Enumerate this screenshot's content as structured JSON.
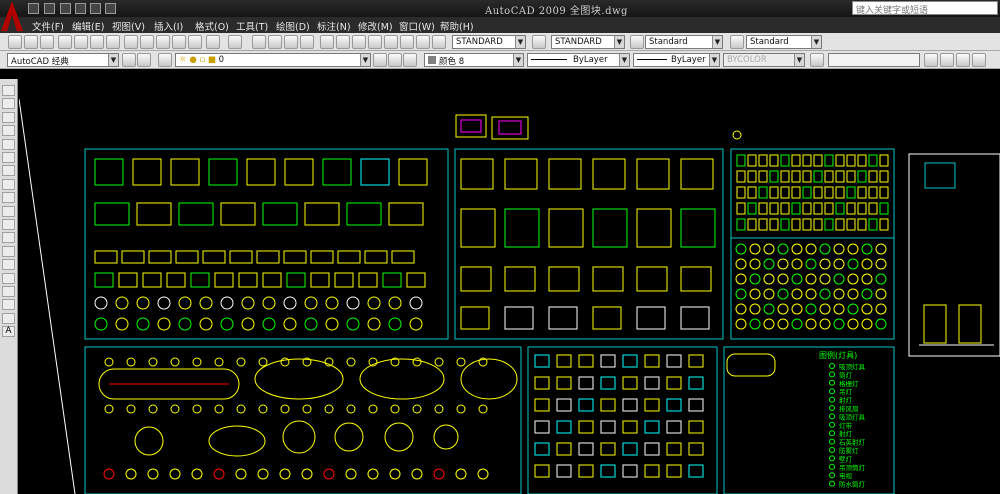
{
  "window": {
    "title": "AutoCAD 2009  全图块.dwg"
  },
  "search": {
    "placeholder": "键入关键字或短语"
  },
  "menu": [
    "文件(F)",
    "编辑(E)",
    "视图(V)",
    "插入(I)",
    "格式(O)",
    "工具(T)",
    "绘图(D)",
    "标注(N)",
    "修改(M)",
    "窗口(W)",
    "帮助(H)"
  ],
  "styles": {
    "text_style": "STANDARD",
    "dim_style": "STANDARD",
    "table_style": "Standard",
    "multileader_style": "Standard"
  },
  "workspace": "AutoCAD 经典",
  "layer": {
    "current": "0"
  },
  "properties": {
    "color": "颜色 8",
    "linetype": "ByLayer",
    "lineweight": "ByLayer",
    "plotstyle": "BYCOLOR"
  },
  "drawing": {
    "legend_title": "图例(灯具)",
    "legend_items": [
      "吸顶灯具",
      "筒灯",
      "格栅灯",
      "吊灯",
      "射灯",
      "排风扇",
      "吸顶灯具",
      "灯带",
      "射灯",
      "石英射灯",
      "防雾灯",
      "壁灯",
      "吊顶筒灯",
      "电视",
      "防水筒灯"
    ]
  },
  "colors": {
    "cyan_frame": "#00c8c8",
    "yellow_block": "#ffff00",
    "green_block": "#00ff00",
    "white_line": "#ffffff",
    "red_accent": "#ff0000",
    "magenta": "#ff00ff"
  },
  "icons": {
    "quick_access": [
      "new-icon",
      "open-icon",
      "save-icon",
      "print-icon",
      "undo-icon",
      "redo-icon"
    ],
    "standard_toolbar": [
      "qnew-icon",
      "open-icon",
      "save-icon",
      "plot-icon",
      "preview-icon",
      "publish-icon",
      "3dprint-icon",
      "cut-icon",
      "copy-icon",
      "paste-icon",
      "matchprop-icon",
      "blockeditor-icon",
      "undo-icon",
      "redo-icon",
      "pan-icon",
      "zoom-realtime-icon",
      "zoom-window-icon",
      "zoom-previous-icon",
      "properties-icon",
      "designcenter-icon",
      "toolpalettes-icon",
      "sheetset-icon",
      "markup-icon",
      "quickcalc-icon",
      "help-icon"
    ],
    "draw_toolbar": [
      "line-icon",
      "xline-icon",
      "polyline-icon",
      "polygon-icon",
      "rectangle-icon",
      "arc-icon",
      "circle-icon",
      "revcloud-icon",
      "spline-icon",
      "ellipse-icon",
      "ellipse-arc-icon",
      "insert-block-icon",
      "make-block-icon",
      "point-icon",
      "hatch-icon",
      "gradient-icon",
      "region-icon",
      "table-icon",
      "mtext-icon"
    ]
  }
}
